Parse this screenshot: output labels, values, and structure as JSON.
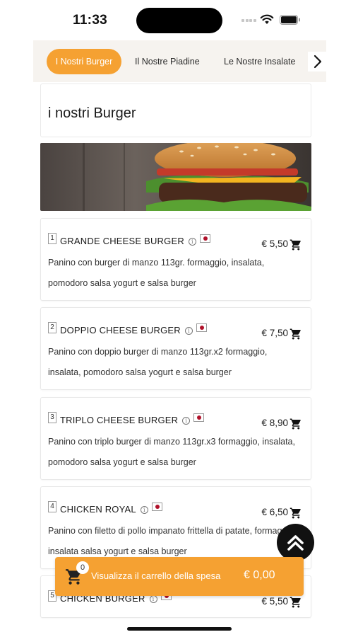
{
  "status_bar": {
    "time": "11:33"
  },
  "tabs": {
    "items": [
      {
        "label": "I Nostri Burger",
        "active": true
      },
      {
        "label": "Il Nostre Piadine",
        "active": false
      },
      {
        "label": "Le Nostre Insalate",
        "active": false
      }
    ],
    "next_icon": "chevron-right-icon"
  },
  "section": {
    "title": "i nostri Burger"
  },
  "products": [
    {
      "num": "1",
      "name": "GRANDE CHEESE BURGER",
      "price": "€ 5,50",
      "description": "Panino con burger di manzo 113gr. formaggio, insalata, pomodoro salsa yogurt e salsa burger"
    },
    {
      "num": "2",
      "name": "DOPPIO CHEESE BURGER",
      "price": "€ 7,50",
      "description": "Panino con doppio burger di manzo 113gr.x2 formaggio, insalata, pomodoro salsa yogurt e salsa burger"
    },
    {
      "num": "3",
      "name": "TRIPLO CHEESE BURGER",
      "price": "€ 8,90",
      "description": "Panino con triplo burger di manzo 113gr.x3 formaggio, insalata, pomodoro salsa yogurt e salsa burger"
    },
    {
      "num": "4",
      "name": "CHICKEN ROYAL",
      "price": "€ 6,50",
      "description": "Panino con filetto di pollo impanato frittella di patate, formaggio, insalata salsa yogurt e salsa burger"
    },
    {
      "num": "5",
      "name": "CHICKEN BURGER",
      "price": "€ 5,50",
      "description": ""
    }
  ],
  "cart": {
    "count": "0",
    "label": "Visualizza il carrello della spesa",
    "total": "€ 0,00"
  },
  "colors": {
    "accent": "#f5a132",
    "tab_bar_bg": "#f6f3ef",
    "dark": "#111111",
    "flag_red": "#b0112a"
  }
}
